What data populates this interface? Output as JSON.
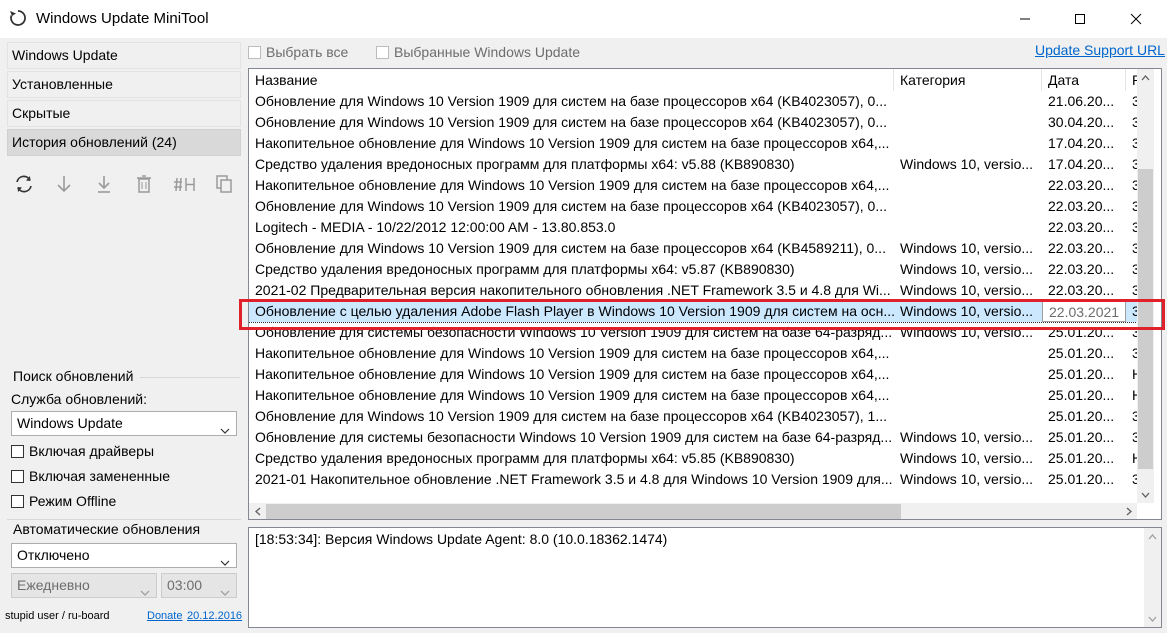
{
  "window": {
    "title": "Windows Update MiniTool",
    "app_icon": "refresh-icon"
  },
  "nav": {
    "items": [
      {
        "label": "Windows Update"
      },
      {
        "label": "Установленные"
      },
      {
        "label": "Скрытые"
      },
      {
        "label": "История обновлений (24)",
        "active": true
      }
    ]
  },
  "toolbar": {
    "icons": [
      "refresh-icon",
      "download-arrow-icon",
      "install-arrow-icon",
      "trash-icon",
      "hide-icon",
      "copy-icon"
    ]
  },
  "search_group": {
    "title": "Поиск обновлений",
    "service_label": "Служба обновлений:",
    "service_value": "Windows Update",
    "include_drivers": "Включая драйверы",
    "include_superseded": "Включая замененные",
    "offline_mode": "Режим Offline"
  },
  "auto_group": {
    "title": "Автоматические обновления",
    "mode_value": "Отключено",
    "schedule_value": "Ежедневно",
    "time_value": "03:00"
  },
  "footer": {
    "credit": "stupid user / ru-board",
    "donate": "Donate",
    "date": "20.12.2016"
  },
  "top_controls": {
    "select_all": "Выбрать все",
    "selected_updates": "Выбранные Windows Update",
    "support_link": "Update Support URL"
  },
  "list": {
    "columns": [
      "Название",
      "Категория",
      "Дата",
      "Р"
    ],
    "rows": [
      {
        "name": "Обновление для Windows 10 Version 1909 для систем на базе процессоров x64 (KB4023057), 0...",
        "category": "",
        "date": "21.06.20...",
        "extra": "3"
      },
      {
        "name": "Обновление для Windows 10 Version 1909 для систем на базе процессоров x64 (KB4023057), 0...",
        "category": "",
        "date": "30.04.20...",
        "extra": "3"
      },
      {
        "name": "Накопительное обновление для Windows 10 Version 1909 для систем на базе процессоров x64,...",
        "category": "",
        "date": "17.04.20...",
        "extra": "3"
      },
      {
        "name": "Средство удаления вредоносных программ для платформы x64: v5.88 (KB890830)",
        "category": "Windows 10, versio...",
        "date": "17.04.20...",
        "extra": "3"
      },
      {
        "name": "Накопительное обновление для Windows 10 Version 1909 для систем на базе процессоров x64,...",
        "category": "",
        "date": "22.03.20...",
        "extra": "3"
      },
      {
        "name": "Обновление для Windows 10 Version 1909 для систем на базе процессоров x64 (KB4023057), 0...",
        "category": "",
        "date": "22.03.20...",
        "extra": "3"
      },
      {
        "name": "Logitech - MEDIA - 10/22/2012 12:00:00 AM - 13.80.853.0",
        "category": "",
        "date": "22.03.20...",
        "extra": "3"
      },
      {
        "name": "Обновление для Windows 10 Version 1909 для систем на базе процессоров x64 (KB4589211), 0...",
        "category": "Windows 10, versio...",
        "date": "22.03.20...",
        "extra": "3"
      },
      {
        "name": "Средство удаления вредоносных программ для платформы x64: v5.87 (KB890830)",
        "category": "Windows 10, versio...",
        "date": "22.03.20...",
        "extra": "3"
      },
      {
        "name": "2021-02 Предварительная версия накопительного обновления .NET Framework 3.5 и 4.8 для Wi...",
        "category": "Windows 10, versio...",
        "date": "22.03.20...",
        "extra": "3"
      },
      {
        "name": "Обновление с целью удаления Adobe Flash Player в Windows 10 Version 1909 для систем на осн...",
        "category": "Windows 10, versio...",
        "date": "22.03.2021",
        "extra": "3",
        "selected": true
      },
      {
        "name": "Обновление для системы безопасности Windows 10 Version 1909 для систем на базе 64-разряд...",
        "category": "Windows 10, versio...",
        "date": "25.01.20...",
        "extra": "3"
      },
      {
        "name": "Накопительное обновление для Windows 10 Version 1909 для систем на базе процессоров x64,...",
        "category": "",
        "date": "25.01.20...",
        "extra": "3"
      },
      {
        "name": "Накопительное обновление для Windows 10 Version 1909 для систем на базе процессоров x64,...",
        "category": "",
        "date": "25.01.20...",
        "extra": "Н"
      },
      {
        "name": "Накопительное обновление для Windows 10 Version 1909 для систем на базе процессоров x64,...",
        "category": "",
        "date": "25.01.20...",
        "extra": "Н"
      },
      {
        "name": "Обновление для Windows 10 Version 1909 для систем на базе процессоров x64 (KB4023057), 1...",
        "category": "",
        "date": "25.01.20...",
        "extra": "3"
      },
      {
        "name": "Обновление для системы безопасности Windows 10 Version 1909 для систем на базе 64-разряд...",
        "category": "Windows 10, versio...",
        "date": "25.01.20...",
        "extra": "3"
      },
      {
        "name": "Средство удаления вредоносных программ для платформы x64: v5.85 (KB890830)",
        "category": "Windows 10, versio...",
        "date": "25.01.20...",
        "extra": "Н"
      },
      {
        "name": "2021-01 Накопительное обновление .NET Framework 3.5 и 4.8 для Windows 10 Version 1909 для...",
        "category": "Windows 10, versio...",
        "date": "25.01.20...",
        "extra": "3"
      }
    ]
  },
  "log": {
    "text": "[18:53:34]: Версия Windows Update Agent: 8.0 (10.0.18362.1474)"
  },
  "colors": {
    "highlight": "#e0202a",
    "selection": "#cce8ff",
    "link": "#0066cc"
  }
}
